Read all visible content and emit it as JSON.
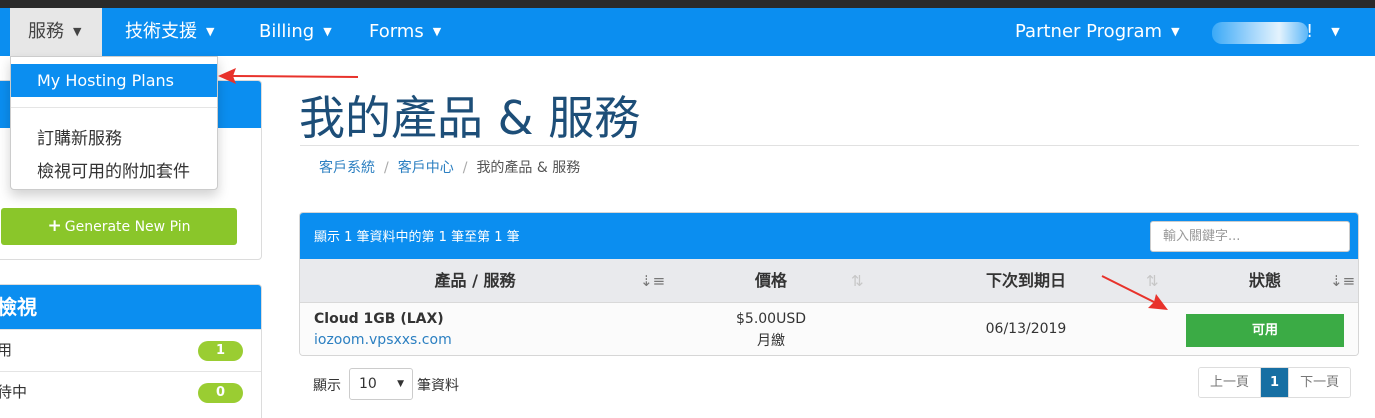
{
  "nav": {
    "services": "服務",
    "support": "技術支援",
    "billing": "Billing",
    "forms": "Forms",
    "partner": "Partner Program",
    "user_suffix": "!"
  },
  "dropdown": {
    "items": [
      "My Hosting Plans",
      "訂購新服務",
      "檢視可用的附加套件"
    ]
  },
  "sidebar": {
    "generate_pin": "Generate New Pin",
    "panel_title": "檢視",
    "rows": [
      {
        "label": "用",
        "count": "1"
      },
      {
        "label": "待中",
        "count": "0"
      }
    ]
  },
  "page": {
    "title": "我的產品 & 服務",
    "breadcrumb": [
      "客戶系統",
      "客戶中心",
      "我的產品 & 服務"
    ]
  },
  "table": {
    "info": "顯示 1 筆資料中的第 1 筆至第 1 筆",
    "search_placeholder": "輸入關鍵字...",
    "headers": {
      "product": "產品 / 服務",
      "price": "價格",
      "due": "下次到期日",
      "status": "狀態"
    },
    "row": {
      "product": "Cloud 1GB (LAX)",
      "host": "iozoom.vpsxxs.com",
      "price": "$5.00USD",
      "cycle": "月繳",
      "due": "06/13/2019",
      "status": "可用"
    }
  },
  "footer": {
    "show": "顯示",
    "per_page": "10",
    "records": "筆資料",
    "prev": "上一頁",
    "page": "1",
    "next": "下一頁"
  },
  "colors": {
    "nav_bg": "#0b8ef0",
    "title": "#1d4e78",
    "status_green": "#3bab45",
    "badge_green": "#9acd32",
    "pin_green": "#8ac62a",
    "annotation_red": "#e8322b"
  },
  "icons": [
    "caret-down-icon",
    "plus-icon",
    "sort-icon",
    "annotation-arrow"
  ]
}
